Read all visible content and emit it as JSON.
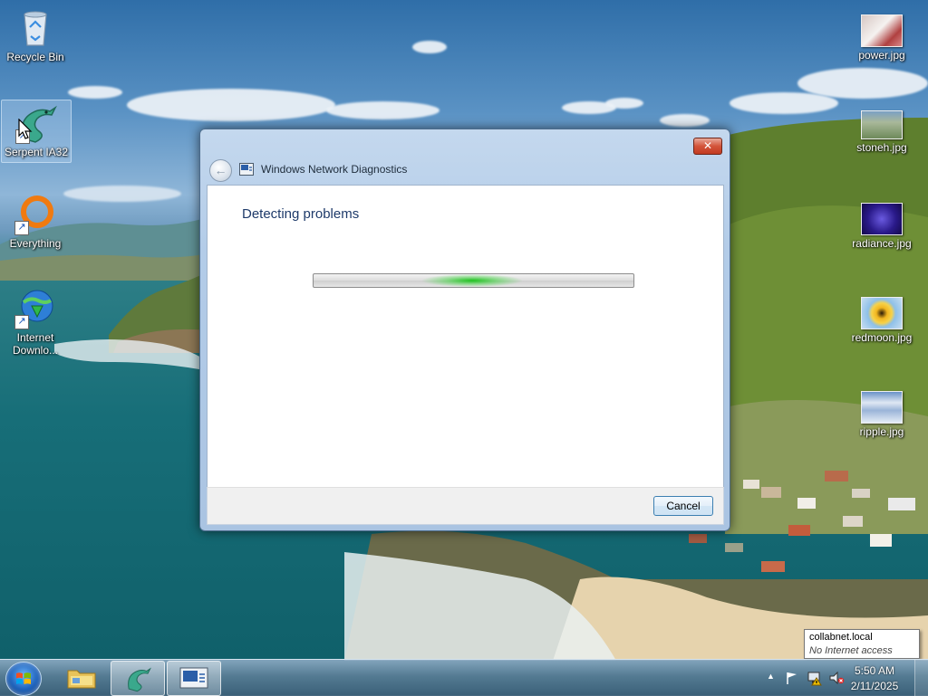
{
  "desktop": {
    "icons_left": [
      {
        "label": "Recycle Bin",
        "icon": "recycle-bin-icon"
      },
      {
        "label": "Serpent IA32",
        "icon": "serpent-dragon-icon"
      },
      {
        "label": "Everything",
        "icon": "everything-search-icon"
      },
      {
        "label": "Internet Downlo...",
        "icon": "internet-download-manager-icon"
      }
    ],
    "icons_right": [
      {
        "label": "power.jpg",
        "icon": "image-file-icon"
      },
      {
        "label": "stoneh.jpg",
        "icon": "image-file-icon"
      },
      {
        "label": "radiance.jpg",
        "icon": "image-file-icon"
      },
      {
        "label": "redmoon.jpg",
        "icon": "image-file-icon"
      },
      {
        "label": "ripple.jpg",
        "icon": "image-file-icon"
      }
    ]
  },
  "dialog": {
    "title": "Windows Network Diagnostics",
    "heading": "Detecting problems",
    "cancel_label": "Cancel",
    "close_glyph": "✕",
    "back_glyph": "←"
  },
  "tooltip": {
    "line1": "collabnet.local",
    "line2": "No Internet access"
  },
  "taskbar": {
    "items": [
      {
        "name": "file-explorer",
        "icon": "folder-icon"
      },
      {
        "name": "serpent-ia32",
        "icon": "serpent-dragon-icon"
      },
      {
        "name": "windows-network-diagnostics",
        "icon": "network-diagnostics-icon"
      }
    ],
    "tray_show_hidden": "▲",
    "time": "5:50 AM",
    "date": "2/11/2025"
  },
  "colors": {
    "dialog_heading": "#1e3a6a",
    "progress_glow": "#1fc21f",
    "close_button": "#c23b22"
  }
}
